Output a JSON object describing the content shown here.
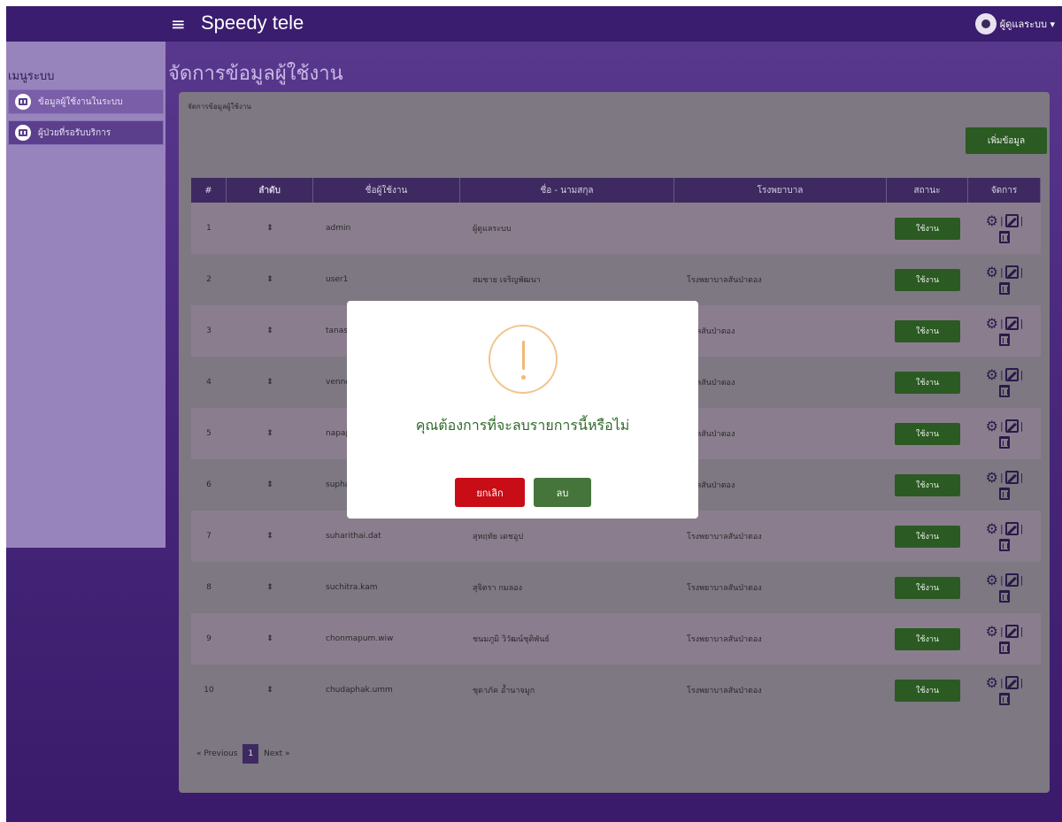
{
  "header": {
    "brand": "Speedy tele",
    "user_label": "ผู้ดูแลระบบ ▾"
  },
  "sidebar": {
    "title": "เมนูระบบ",
    "items": [
      {
        "label": "ข้อมูลผู้ใช้งานในระบบ"
      },
      {
        "label": "ผู้ป่วยที่รอรับบริการ"
      }
    ]
  },
  "main": {
    "page_title": "จัดการข้อมูลผู้ใช้งาน",
    "breadcrumb": "จัดการข้อมูลผู้ใช้งาน",
    "add_button": "เพิ่มข้อมูล",
    "columns": [
      "#",
      "ลำดับ",
      "ชื่อผู้ใช้งาน",
      "ชื่อ - นามสกุล",
      "โรงพยาบาล",
      "สถานะ",
      "จัดการ"
    ],
    "rows": [
      {
        "num": "1",
        "ord": "⇕",
        "user": "admin",
        "name": "ผู้ดูแลระบบ",
        "hosp": "",
        "status": "ใช้งาน"
      },
      {
        "num": "2",
        "ord": "⇕",
        "user": "user1",
        "name": "สมชาย เจริญพัฒนา",
        "hosp": "โรงพยาบาลสันป่าตอง",
        "status": "ใช้งาน"
      },
      {
        "num": "3",
        "ord": "⇕",
        "user": "tanasit.wi",
        "name": "",
        "hosp": "บาลสันป่าตอง",
        "status": "ใช้งาน"
      },
      {
        "num": "4",
        "ord": "⇕",
        "user": "vennee.pa",
        "name": "",
        "hosp": "บาลสันป่าตอง",
        "status": "ใช้งาน"
      },
      {
        "num": "5",
        "ord": "⇕",
        "user": "napaporn",
        "name": "",
        "hosp": "บาลสันป่าตอง",
        "status": "ใช้งาน"
      },
      {
        "num": "6",
        "ord": "⇕",
        "user": "suphanan",
        "name": "",
        "hosp": "บาลสันป่าตอง",
        "status": "ใช้งาน"
      },
      {
        "num": "7",
        "ord": "⇕",
        "user": "suharithai.dat",
        "name": "สุหฤทัย เดชอูป",
        "hosp": "โรงพยาบาลสันป่าตอง",
        "status": "ใช้งาน"
      },
      {
        "num": "8",
        "ord": "⇕",
        "user": "suchitra.kam",
        "name": "สุจิตรา กมลอง",
        "hosp": "โรงพยาบาลสันป่าตอง",
        "status": "ใช้งาน"
      },
      {
        "num": "9",
        "ord": "⇕",
        "user": "chonmapum.wiw",
        "name": "ชนมภูมิ วิวัฒน์ชุติพันธ์",
        "hosp": "โรงพยาบาลสันป่าตอง",
        "status": "ใช้งาน"
      },
      {
        "num": "10",
        "ord": "⇕",
        "user": "chudaphak.umm",
        "name": "ชุดาภัค อ้ำนาจมูก",
        "hosp": "โรงพยาบาลสันป่าตอง",
        "status": "ใช้งาน"
      }
    ],
    "pagination": {
      "prev": "« Previous",
      "current": "1",
      "next": "Next »"
    }
  },
  "modal": {
    "message": "คุณต้องการที่จะลบรายการนี้หรือไม่",
    "cancel": "ยกเลิก",
    "confirm": "ลบ",
    "icon": "warning-icon"
  },
  "colors": {
    "header": "#3a1d6e",
    "sidebar": "#9884bd",
    "button_green": "#2b5a23",
    "cancel_red": "#c80d16",
    "confirm_green": "#45753b",
    "warning_orange": "#f2c48e"
  }
}
